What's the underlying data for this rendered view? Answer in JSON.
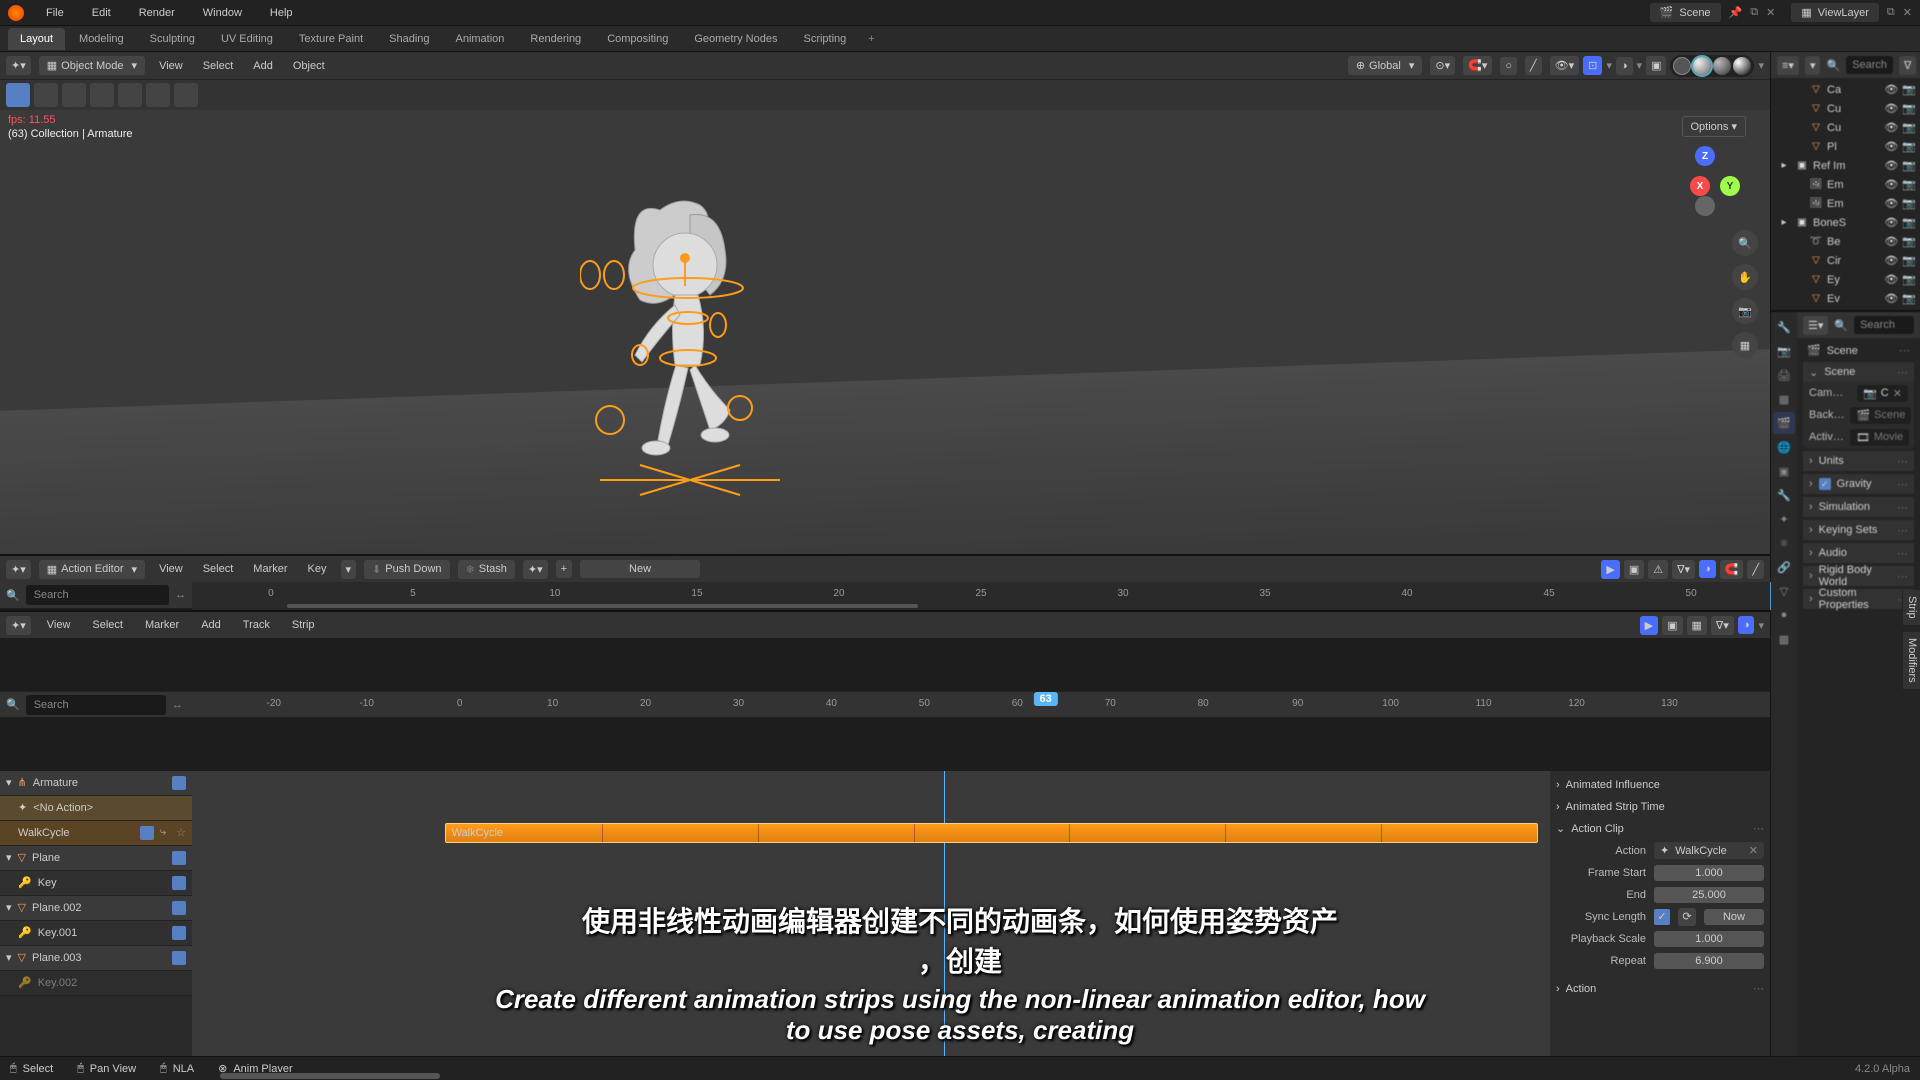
{
  "top_menu": {
    "items": [
      "File",
      "Edit",
      "Render",
      "Window",
      "Help"
    ]
  },
  "workspaces": {
    "tabs": [
      "Layout",
      "Modeling",
      "Sculpting",
      "UV Editing",
      "Texture Paint",
      "Shading",
      "Animation",
      "Rendering",
      "Compositing",
      "Geometry Nodes",
      "Scripting"
    ],
    "active": "Layout"
  },
  "scene_selector": {
    "label": "Scene"
  },
  "layer_selector": {
    "label": "ViewLayer"
  },
  "viewport_header": {
    "mode": "Object Mode",
    "menus": [
      "View",
      "Select",
      "Add",
      "Object"
    ],
    "orientation": "Global"
  },
  "viewport_overlay": {
    "fps": "fps: 11.55",
    "breadcrumb": "(63) Collection | Armature",
    "options": "Options"
  },
  "gizmo": {
    "x": "X",
    "y": "Y",
    "z": "Z"
  },
  "action_editor": {
    "mode": "Action Editor",
    "menus": [
      "View",
      "Select",
      "Marker",
      "Key"
    ],
    "push_down": "Push Down",
    "stash": "Stash",
    "new": "New",
    "search_placeholder": "Search"
  },
  "action_ruler": {
    "ticks": [
      "0",
      "5",
      "10",
      "15",
      "20",
      "25",
      "30",
      "35",
      "40",
      "45",
      "50"
    ]
  },
  "nla": {
    "menus": [
      "View",
      "Select",
      "Marker",
      "Add",
      "Track",
      "Strip"
    ],
    "search_placeholder": "Search",
    "current_frame": "63",
    "ruler_ticks": [
      "-20",
      "-10",
      "0",
      "10",
      "20",
      "30",
      "40",
      "50",
      "60",
      "70",
      "80",
      "90",
      "100",
      "110",
      "120",
      "130"
    ],
    "tracks": [
      {
        "type": "obj",
        "name": "Armature"
      },
      {
        "type": "noact",
        "name": "<No Action>"
      },
      {
        "type": "strip",
        "name": "WalkCycle"
      },
      {
        "type": "obj",
        "name": "Plane"
      },
      {
        "type": "track",
        "name": "Key"
      },
      {
        "type": "obj",
        "name": "Plane.002"
      },
      {
        "type": "track",
        "name": "Key.001"
      },
      {
        "type": "obj",
        "name": "Plane.003"
      },
      {
        "type": "track",
        "name": "Key.002"
      }
    ],
    "strip_label": "WalkCycle"
  },
  "nla_side": {
    "animated_influence": "Animated Influence",
    "animated_strip_time": "Animated Strip Time",
    "action_clip": "Action Clip",
    "action_label": "Action",
    "action_value": "WalkCycle",
    "frame_start_label": "Frame Start",
    "frame_start": "1.000",
    "end_label": "End",
    "end": "25.000",
    "sync_label": "Sync Length",
    "sync_check": true,
    "now": "Now",
    "playback_label": "Playback Scale",
    "playback": "1.000",
    "repeat_label": "Repeat",
    "repeat": "6.900",
    "action_panel": "Action"
  },
  "side_tabs": {
    "strip": "Strip",
    "modifiers": "Modifiers"
  },
  "outliner": {
    "search_placeholder": "Search",
    "rows": [
      {
        "lvl": 1,
        "icon": "mesh",
        "name": "Ca"
      },
      {
        "lvl": 1,
        "icon": "mesh",
        "name": "Cu"
      },
      {
        "lvl": 1,
        "icon": "mesh",
        "name": "Cu"
      },
      {
        "lvl": 1,
        "icon": "mesh",
        "name": "Pl"
      },
      {
        "lvl": 0,
        "icon": "coll",
        "name": "Ref Im"
      },
      {
        "lvl": 1,
        "icon": "img",
        "name": "Em"
      },
      {
        "lvl": 1,
        "icon": "img",
        "name": "Em"
      },
      {
        "lvl": 0,
        "icon": "coll",
        "name": "BoneS"
      },
      {
        "lvl": 1,
        "icon": "curve",
        "name": "Be"
      },
      {
        "lvl": 1,
        "icon": "mesh",
        "name": "Cir"
      },
      {
        "lvl": 1,
        "icon": "mesh",
        "name": "Ey"
      },
      {
        "lvl": 1,
        "icon": "mesh",
        "name": "Ev"
      }
    ]
  },
  "properties": {
    "search_placeholder": "Search",
    "breadcrumb": "Scene",
    "scene_panel": "Scene",
    "cam_label": "Cam…",
    "cam_val": "C",
    "back_label": "Back…",
    "back_val": "Scene",
    "active_label": "Activ…",
    "active_val": "Movie",
    "panels": [
      "Units",
      "Gravity",
      "Simulation",
      "Keying Sets",
      "Audio",
      "Rigid Body World",
      "Custom Properties"
    ],
    "gravity_check": true
  },
  "status_bar": {
    "select": "Select",
    "pan": "Pan View",
    "nla": "NLA",
    "anim": "Anim Player",
    "version": "4.2.0 Alpha"
  },
  "subtitle": {
    "cn1": "使用非线性动画编辑器创建不同的动画条，如何使用姿势资产",
    "cn2": "，创建",
    "en": "Create different animation strips using the non-linear animation editor, how to use pose assets, creating"
  }
}
